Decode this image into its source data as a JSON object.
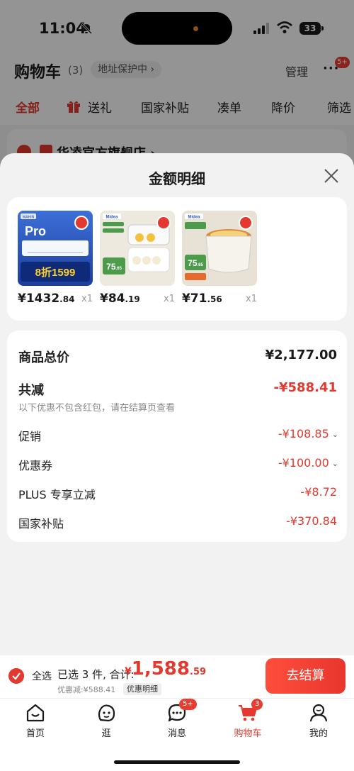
{
  "status_bar": {
    "time": "11:04",
    "battery": "33"
  },
  "cart": {
    "title": "购物车",
    "count": "(3)",
    "address_protect": "地址保护中 ›",
    "manage": "管理",
    "more_badge": "5+",
    "filter_tabs": [
      "全部",
      "送礼",
      "国家补贴",
      "凑单",
      "降价",
      "筛选"
    ],
    "store_name": "华凌官方旗舰店 ›"
  },
  "sheet": {
    "title": "金额明细",
    "products": [
      {
        "price_int": "¥1432",
        "price_dec": ".84",
        "qty": "x1"
      },
      {
        "price_int": "¥84",
        "price_dec": ".19",
        "qty": "x1"
      },
      {
        "price_int": "¥71",
        "price_dec": ".56",
        "qty": "x1"
      }
    ],
    "product_images": {
      "p1": {
        "brand": "WAHIN",
        "pro": "Pro",
        "promo": "8折1599"
      },
      "p2": {
        "brand": "Midea",
        "price": "75",
        "price_dec": ".65"
      },
      "p3": {
        "brand": "Midea",
        "price": "75",
        "price_dec": ".65"
      }
    },
    "rows": {
      "goods_total": {
        "label": "商品总价",
        "value": "¥2,177.00"
      },
      "total_reduce": {
        "label": "共减",
        "value": "-¥588.41"
      },
      "note": "以下优惠不包含红包，请在结算页查看",
      "promo": {
        "label": "促销",
        "value": "-¥108.85"
      },
      "coupon": {
        "label": "优惠券",
        "value": "-¥100.00"
      },
      "plus": {
        "label": "PLUS 专享立减",
        "value": "-¥8.72"
      },
      "subsidy": {
        "label": "国家补贴",
        "value": "-¥370.84"
      }
    }
  },
  "checkout": {
    "select_all": "全选",
    "selected": "已选 3 件, 合计:",
    "total_cur": "¥",
    "total_int": "1,588",
    "total_dec": ".59",
    "saved": "优惠减:¥588.41",
    "detail": "优惠明细",
    "button": "去结算"
  },
  "tabbar": [
    {
      "label": "首页",
      "icon": "home-icon"
    },
    {
      "label": "逛",
      "icon": "browse-icon"
    },
    {
      "label": "消息",
      "icon": "message-icon",
      "badge": "5+"
    },
    {
      "label": "购物车",
      "icon": "cart-icon",
      "badge": "3"
    },
    {
      "label": "我的",
      "icon": "profile-icon"
    }
  ],
  "colors": {
    "accent": "#e3392f",
    "sheet_bg": "#f2f2f2"
  }
}
